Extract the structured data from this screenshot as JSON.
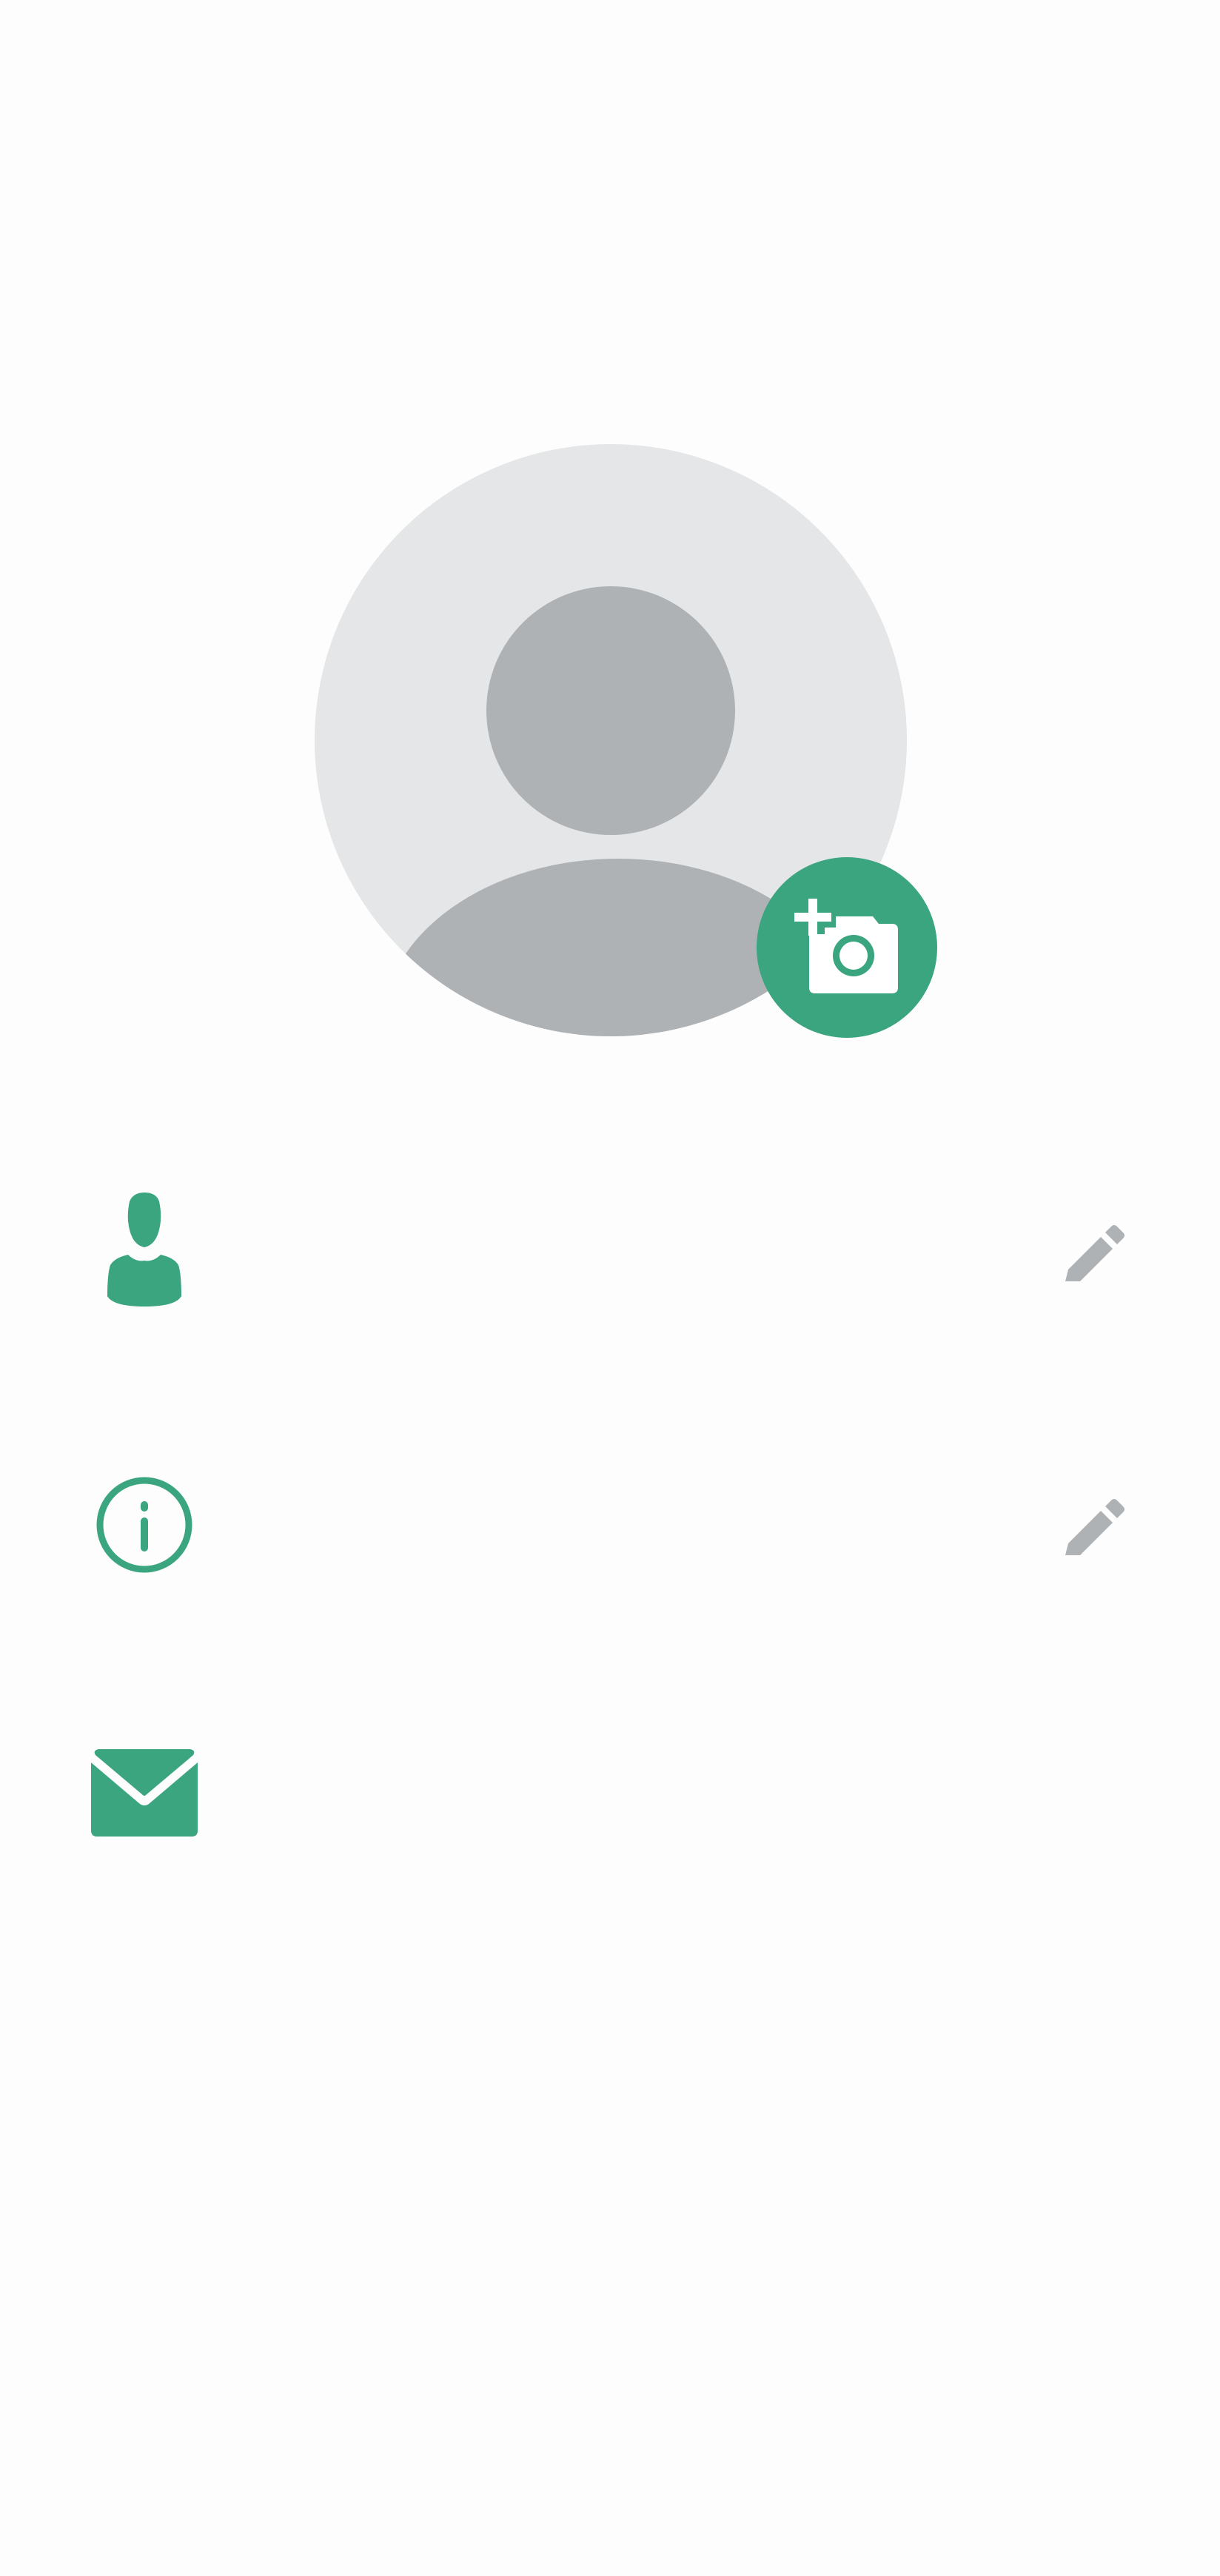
{
  "colors": {
    "accent": "#3aa57e",
    "avatar_bg": "#e5e6e7",
    "avatar_figure": "#aeb2b5",
    "edit_icon": "#aeb2b5",
    "background": "#fdfdfd"
  },
  "profile": {
    "avatar_icon": "person-silhouette-icon",
    "camera_icon": "add-photo-icon"
  },
  "rows": {
    "name": {
      "icon": "person-icon",
      "value": "",
      "edit_icon": "pencil-icon"
    },
    "about": {
      "icon": "info-icon",
      "value": "",
      "edit_icon": "pencil-icon"
    },
    "email": {
      "icon": "mail-icon",
      "value": ""
    }
  }
}
